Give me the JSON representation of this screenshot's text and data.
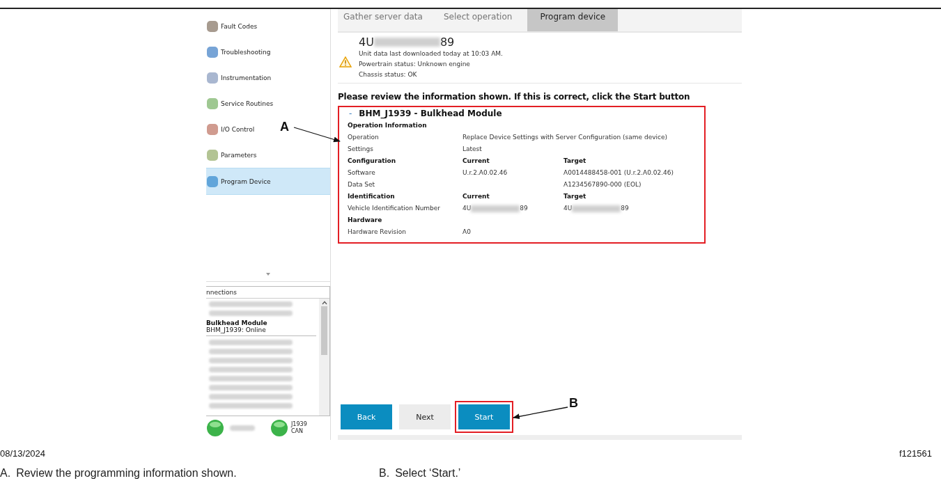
{
  "sidebar": {
    "items": [
      {
        "label": "Fault Codes",
        "selected": false
      },
      {
        "label": "Troubleshooting",
        "selected": false
      },
      {
        "label": "Instrumentation",
        "selected": false
      },
      {
        "label": "Service Routines",
        "selected": false
      },
      {
        "label": "I/O Control",
        "selected": false
      },
      {
        "label": "Parameters",
        "selected": false
      },
      {
        "label": "Program Device",
        "selected": true
      }
    ]
  },
  "connections": {
    "header": "nnections",
    "items": [
      {
        "kind": "redacted"
      },
      {
        "kind": "redacted"
      },
      {
        "kind": "device",
        "name": "Bulkhead Module",
        "status": "BHM_J1939: Online"
      },
      {
        "kind": "redacted"
      },
      {
        "kind": "redacted"
      },
      {
        "kind": "redacted"
      },
      {
        "kind": "redacted"
      },
      {
        "kind": "redacted"
      },
      {
        "kind": "redacted"
      },
      {
        "kind": "redacted"
      },
      {
        "kind": "redacted"
      }
    ]
  },
  "indicators": [
    {
      "kind": "redacted"
    },
    {
      "kind": "label",
      "lines": [
        "J1939",
        "CAN"
      ]
    }
  ],
  "tabs": [
    {
      "label": "Gather server data",
      "selected": false
    },
    {
      "label": "Select operation",
      "selected": false
    },
    {
      "label": "Program device",
      "selected": true
    }
  ],
  "unit": {
    "vin_start": "4U",
    "vin_end": "89",
    "lines": [
      "Unit data last downloaded today at 10:03 AM.",
      "Powertrain status: Unknown engine",
      "Chassis status: OK"
    ]
  },
  "instruction": "Please review the information shown. If this is correct, click the Start button",
  "module": {
    "expander": "-",
    "title": "BHM_J1939 - Bulkhead Module",
    "rows": [
      {
        "kind": "heading",
        "cells": [
          "Operation Information"
        ]
      },
      {
        "kind": "wide",
        "cells": [
          "Operation",
          "Replace Device Settings with Server Configuration (same device)"
        ]
      },
      {
        "kind": "row",
        "cells": [
          "Settings",
          "Latest"
        ]
      },
      {
        "kind": "heading",
        "cells": [
          "Configuration",
          "Current",
          "Target"
        ]
      },
      {
        "kind": "row",
        "cells": [
          "Software",
          "U.r.2.A0.02.46",
          "A0014488458-001 (U.r.2.A0.02.46)"
        ]
      },
      {
        "kind": "row",
        "cells": [
          "Data Set",
          "",
          "A1234567890-000 (EOL)"
        ]
      },
      {
        "kind": "heading",
        "cells": [
          "Identification",
          "Current",
          "Target"
        ]
      },
      {
        "kind": "vin",
        "label": "Vehicle Identification Number",
        "current": {
          "start": "4U",
          "end": "89"
        },
        "target": {
          "start": "4U",
          "end": "89"
        }
      },
      {
        "kind": "heading",
        "cells": [
          "Hardware"
        ]
      },
      {
        "kind": "row",
        "cells": [
          "Hardware Revision",
          "A0"
        ]
      }
    ]
  },
  "buttons": [
    {
      "label": "Back",
      "kind": "primary",
      "highlighted": false
    },
    {
      "label": "Next",
      "kind": "secondary",
      "highlighted": false
    },
    {
      "label": "Start",
      "kind": "primary",
      "highlighted": true
    }
  ],
  "callouts": [
    {
      "letter": "A"
    },
    {
      "letter": "B"
    }
  ],
  "footer": {
    "date": "08/13/2024",
    "figure_id": "f121561"
  },
  "captions": [
    {
      "letter": "A.",
      "text": "Review the programming information shown."
    },
    {
      "letter": "B.",
      "text": "Select ‘Start.’"
    }
  ]
}
